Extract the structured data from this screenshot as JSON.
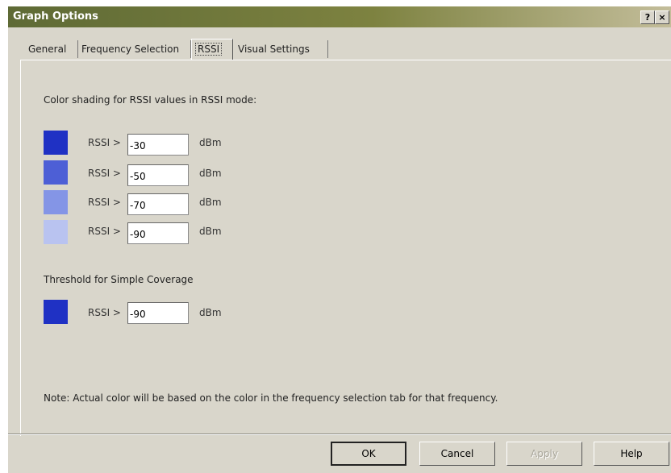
{
  "window": {
    "title": "Graph Options",
    "help_glyph": "?",
    "close_glyph": "×"
  },
  "tabs": [
    {
      "label": "General"
    },
    {
      "label": "Frequency Selection"
    },
    {
      "label": "RSSI",
      "active": true
    },
    {
      "label": "Visual Settings"
    }
  ],
  "rssi": {
    "shading_heading": "Color shading for RSSI values in RSSI mode:",
    "rows": [
      {
        "label": "RSSI >",
        "value": "-30",
        "unit": "dBm",
        "color": "#1f31c4"
      },
      {
        "label": "RSSI >",
        "value": "-50",
        "unit": "dBm",
        "color": "#4d5fd6"
      },
      {
        "label": "RSSI >",
        "value": "-70",
        "unit": "dBm",
        "color": "#8495e6"
      },
      {
        "label": "RSSI >",
        "value": "-90",
        "unit": "dBm",
        "color": "#b9c3f0"
      }
    ],
    "threshold_heading": "Threshold for Simple Coverage",
    "threshold": {
      "label": "RSSI >",
      "value": "-90",
      "unit": "dBm",
      "color": "#1f31c4"
    },
    "note": "Note: Actual color will be based on the color in the frequency selection tab for that frequency."
  },
  "buttons": {
    "ok": "OK",
    "cancel": "Cancel",
    "apply": "Apply",
    "help": "Help"
  }
}
